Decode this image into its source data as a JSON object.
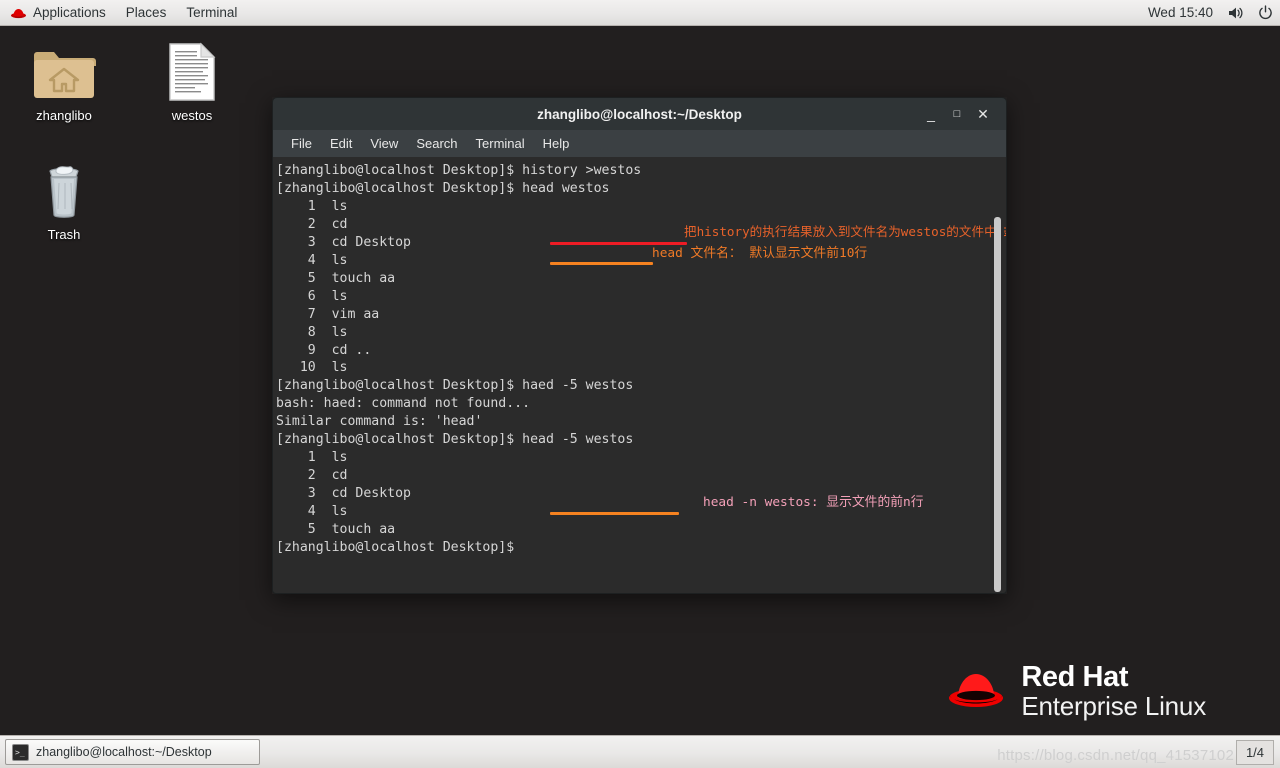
{
  "top_panel": {
    "logo_icon": "redhat-icon",
    "items": [
      {
        "label": "Applications",
        "name": "applications-menu"
      },
      {
        "label": "Places",
        "name": "places-menu"
      },
      {
        "label": "Terminal",
        "name": "terminal-menu"
      }
    ],
    "clock": "Wed 15:40",
    "volume_icon": "volume-icon",
    "power_icon": "power-icon"
  },
  "desktop": {
    "icons": [
      {
        "label": "zhanglibo",
        "icon": "home-folder-icon"
      },
      {
        "label": "westos",
        "icon": "text-document-icon"
      },
      {
        "label": "Trash",
        "icon": "trash-icon"
      }
    ],
    "brand": {
      "line1": "Red Hat",
      "line2": "Enterprise Linux",
      "icon": "redhat-fedora-logo"
    },
    "background_color": "#221f1f"
  },
  "terminal": {
    "title": "zhanglibo@localhost:~/Desktop",
    "menus": [
      "File",
      "Edit",
      "View",
      "Search",
      "Terminal",
      "Help"
    ],
    "window_buttons": {
      "minimize": "_",
      "maximize": "□",
      "close": "✕"
    },
    "background_color": "#2b2b2b",
    "foreground_color": "#d6d6d6",
    "prompt": "[zhanglibo@localhost Desktop]$ ",
    "content": "[zhanglibo@localhost Desktop]$ history >westos\n[zhanglibo@localhost Desktop]$ head westos\n    1  ls\n    2  cd\n    3  cd Desktop\n    4  ls\n    5  touch aa\n    6  ls\n    7  vim aa\n    8  ls\n    9  cd ..\n   10  ls\n[zhanglibo@localhost Desktop]$ haed -5 westos\nbash: haed: command not found...\nSimilar command is: 'head'\n[zhanglibo@localhost Desktop]$ head -5 westos\n    1  ls\n    2  cd\n    3  cd Desktop\n    4  ls\n    5  touch aa\n[zhanglibo@localhost Desktop]$ ",
    "lines": [
      "[zhanglibo@localhost Desktop]$ history >westos",
      "[zhanglibo@localhost Desktop]$ head westos",
      "    1  ls",
      "    2  cd",
      "    3  cd Desktop",
      "    4  ls",
      "    5  touch aa",
      "    6  ls",
      "    7  vim aa",
      "    8  ls",
      "    9  cd ..",
      "   10  ls",
      "[zhanglibo@localhost Desktop]$ haed -5 westos",
      "bash: haed: command not found...",
      "Similar command is: 'head'",
      "[zhanglibo@localhost Desktop]$ head -5 westos",
      "    1  ls",
      "    2  cd",
      "    3  cd Desktop",
      "    4  ls",
      "    5  touch aa",
      "[zhanglibo@localhost Desktop]$ "
    ],
    "annotations": [
      {
        "text": "把history的执行结果放入到文件名为westos的文件中去",
        "color": "#e8622a",
        "name": "annotation-history-redirect"
      },
      {
        "text": "head 文件名：  默认显示文件前10行",
        "color": "#f07a27",
        "name": "annotation-head-default"
      },
      {
        "text": "head -n westos: 显示文件的前n行",
        "color": "#f3a0b8",
        "name": "annotation-head-n"
      }
    ],
    "underlines": [
      {
        "color": "#ee1c25",
        "name": "underline-history-command"
      },
      {
        "color": "#f58220",
        "name": "underline-head-westos"
      },
      {
        "color": "#f58220",
        "name": "underline-head-5-westos"
      }
    ]
  },
  "taskbar": {
    "window_button": "zhanglibo@localhost:~/Desktop",
    "window_button_icon": "terminal-icon",
    "watermark": "https://blog.csdn.net/qq_41537102",
    "workspace": "1/4"
  }
}
